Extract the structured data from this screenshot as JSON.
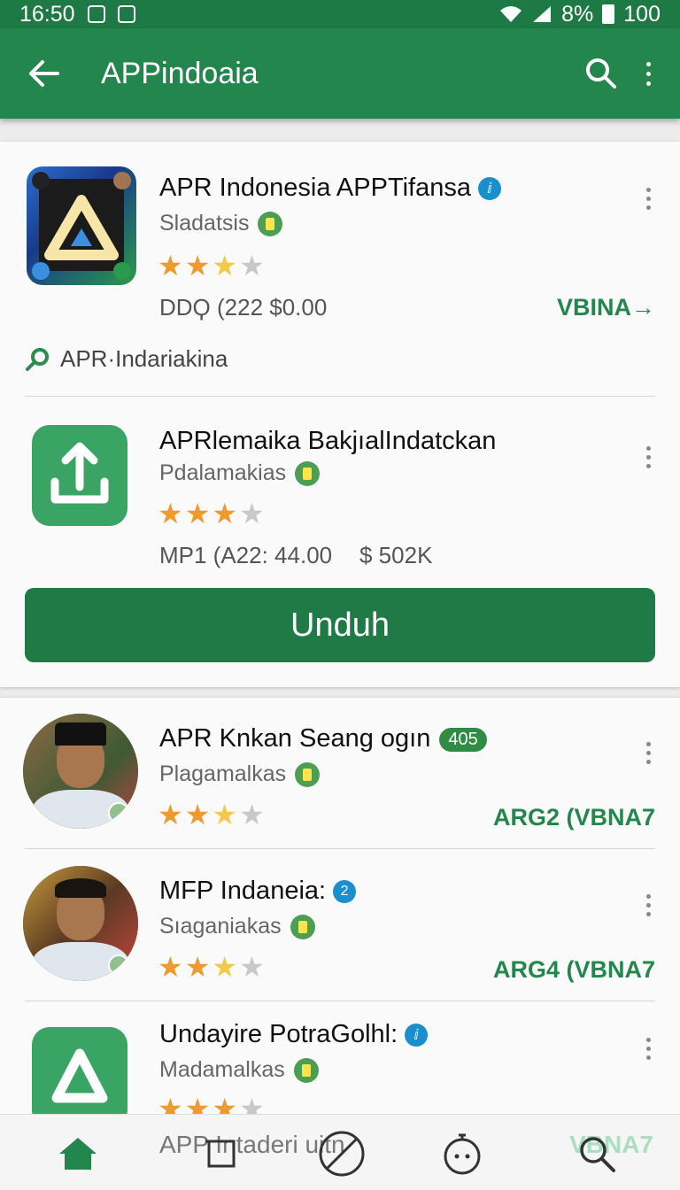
{
  "status_bar": {
    "time": "16:50",
    "battery": "8%",
    "right_number": "100"
  },
  "app_bar": {
    "title": "APPindoaia",
    "back_icon": "arrow-left-icon",
    "search_icon": "search-icon",
    "more_icon": "more-vert-icon"
  },
  "featured": {
    "app1": {
      "title": "APR Indonesia APPTifansa",
      "badge": "ⅈ",
      "developer": "Sladatsis",
      "rating": 2.5,
      "meta": "DDϘ (222 $0.00",
      "action": "VBINA→"
    },
    "tag": {
      "icon": "search-icon",
      "text": "APR·Indariakina"
    },
    "app2": {
      "title": "APRlemaika BakjıalIndatckan",
      "developer": "Pdalamakias",
      "rating": 3,
      "meta_left": "MP1 (A22: 44.00",
      "meta_right": "$ 502K"
    },
    "download_label": "Unduh"
  },
  "list": [
    {
      "title": "APR Knkan Seang ogın",
      "count": "405",
      "developer": "Plagamalkas",
      "rating": 2.5,
      "action": "ARG2  (VBNA7"
    },
    {
      "title": "MFP Indaneia:",
      "badge": "2",
      "developer": "Sıaganiakas",
      "rating": 2.5,
      "action": "ARG4  (VBNA7"
    },
    {
      "title": "Undayire PotraGolhl:",
      "badge": "ⅈ",
      "developer": "Madamalkas",
      "rating": 3
    }
  ],
  "bottom_nav": {
    "peek_text": "APP  Intaderi  uitn",
    "peek_right": "VBNA7",
    "items": [
      "home-icon",
      "square-icon",
      "block-icon",
      "timer-icon",
      "search-icon"
    ]
  },
  "colors": {
    "primary": "#23874d",
    "primary_dark": "#1e7a44",
    "star": "#ef9a2f"
  }
}
